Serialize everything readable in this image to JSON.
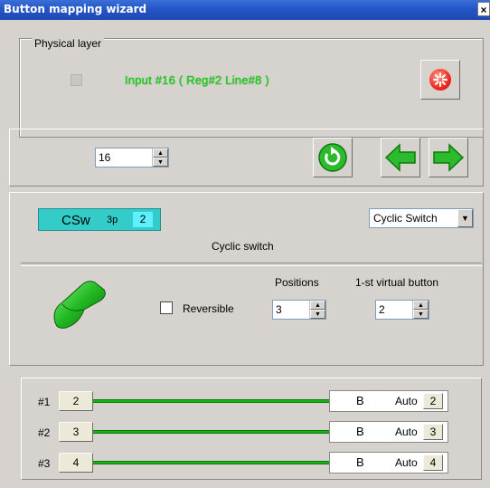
{
  "window": {
    "title": "Button mapping wizard",
    "close_glyph": "×"
  },
  "physical": {
    "group_label": "Physical layer",
    "input_text": "Input #16  ( Reg#2  Line#8 )",
    "stop_icon": "red-star-icon"
  },
  "nav": {
    "input_number": "16",
    "refresh_icon": "green-refresh-icon",
    "back_icon": "green-arrow-left-icon",
    "forward_icon": "green-arrow-right-icon"
  },
  "switch": {
    "type_label": "CSw",
    "sub_label": "3p",
    "count": "2",
    "combo_value": "Cyclic Switch",
    "description": "Cyclic switch"
  },
  "options": {
    "reversible_label": "Reversible",
    "positions_label": "Positions",
    "positions_value": "3",
    "virtual_label": "1-st virtual button",
    "virtual_value": "2"
  },
  "mappings": [
    {
      "label": "#1",
      "button": "2",
      "letter": "B",
      "mode": "Auto",
      "target": "2"
    },
    {
      "label": "#2",
      "button": "3",
      "letter": "B",
      "mode": "Auto",
      "target": "3"
    },
    {
      "label": "#3",
      "button": "4",
      "letter": "B",
      "mode": "Auto",
      "target": "4"
    }
  ],
  "colors": {
    "accent_green": "#18b318",
    "csw_cyan": "#33ccc9",
    "titlebar_blue": "#2456c8",
    "input_text_green": "#19d414"
  }
}
